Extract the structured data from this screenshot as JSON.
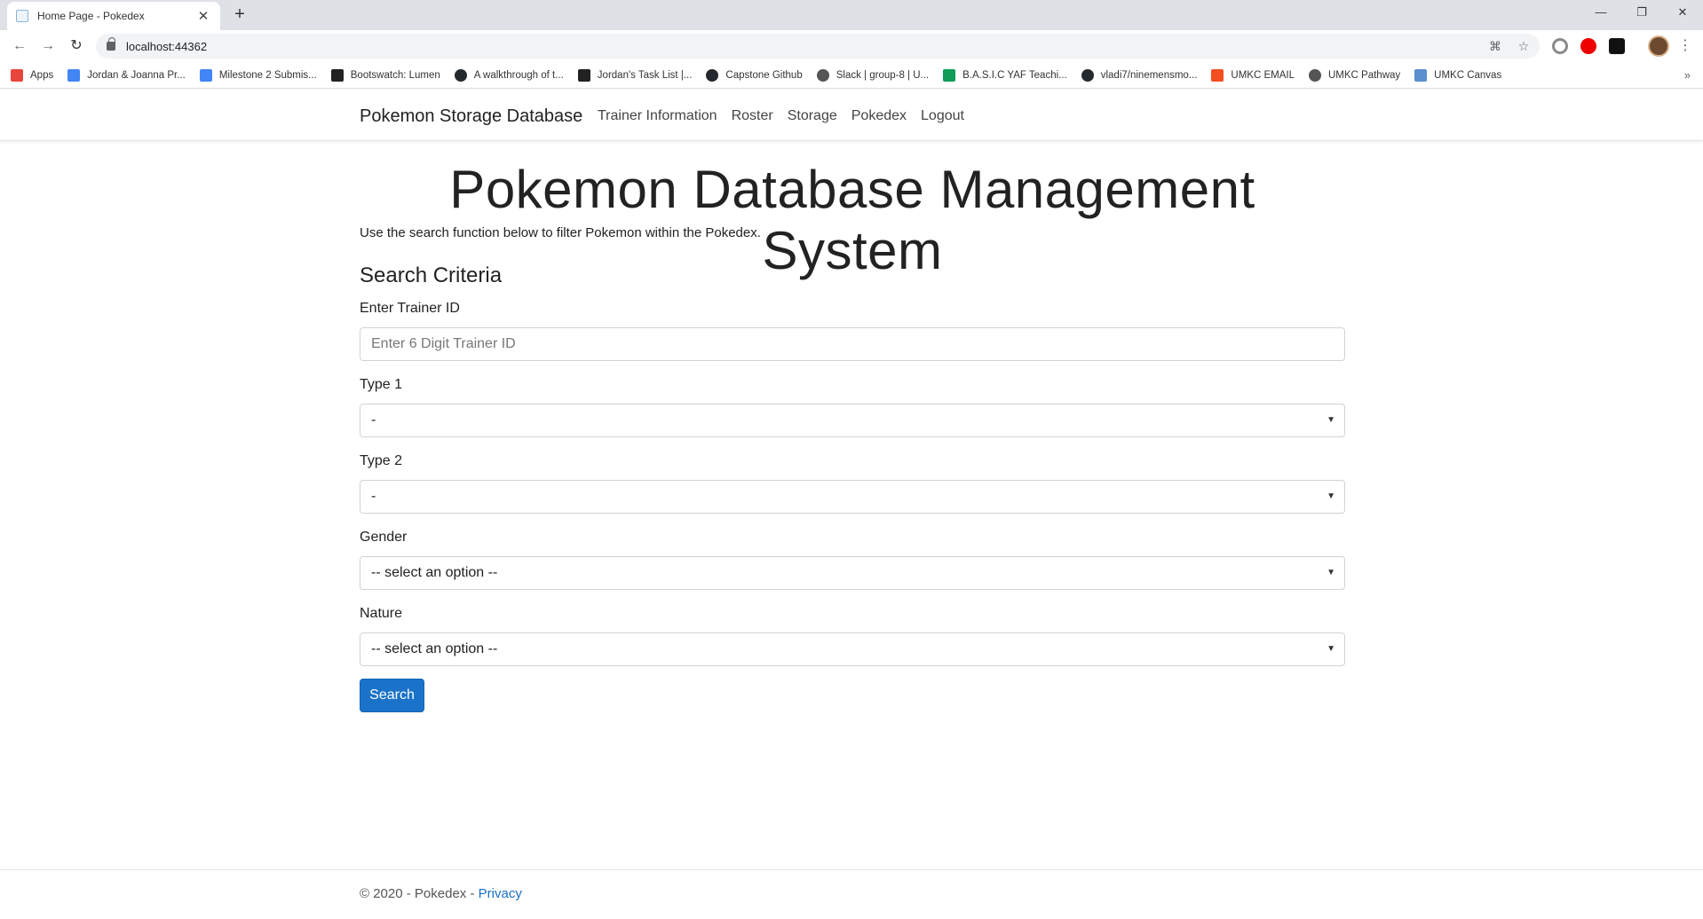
{
  "browser": {
    "tab_title": "Home Page - Pokedex",
    "url": "localhost:44362",
    "bookmarks": [
      {
        "label": "Apps",
        "icon": "apps-grid-icon",
        "color": "#e8453c"
      },
      {
        "label": "Jordan & Joanna Pr...",
        "icon": "google-docs-icon",
        "color": "#4285f4"
      },
      {
        "label": "Milestone 2 Submis...",
        "icon": "google-docs-icon",
        "color": "#4285f4"
      },
      {
        "label": "Bootswatch: Lumen",
        "icon": "bootswatch-icon",
        "color": "#222222"
      },
      {
        "label": "A walkthrough of t...",
        "icon": "github-icon",
        "color": "#24292e"
      },
      {
        "label": "Jordan's Task List |...",
        "icon": "trello-icon",
        "color": "#222222"
      },
      {
        "label": "Capstone Github",
        "icon": "github-icon",
        "color": "#24292e"
      },
      {
        "label": "Slack | group-8 | U...",
        "icon": "globe-icon",
        "color": "#555555"
      },
      {
        "label": "B.A.S.I.C YAF Teachi...",
        "icon": "google-sheets-icon",
        "color": "#0f9d58"
      },
      {
        "label": "vladi7/ninemensmo...",
        "icon": "github-icon",
        "color": "#24292e"
      },
      {
        "label": "UMKC EMAIL",
        "icon": "microsoft-icon",
        "color": "#f25022"
      },
      {
        "label": "UMKC Pathway",
        "icon": "globe-icon",
        "color": "#555555"
      },
      {
        "label": "UMKC Canvas",
        "icon": "umkc-icon",
        "color": "#5b8fd0"
      }
    ]
  },
  "nav": {
    "brand": "Pokemon Storage Database",
    "links": [
      "Trainer Information",
      "Roster",
      "Storage",
      "Pokedex",
      "Logout"
    ]
  },
  "main": {
    "title": "Pokemon Database Management System",
    "intro": "Use the search function below to filter Pokemon within the Pokedex.",
    "section_title": "Search Criteria",
    "trainer_label": "Enter Trainer ID",
    "trainer_placeholder": "Enter 6 Digit Trainer ID",
    "type1_label": "Type 1",
    "type1_value": "-",
    "type2_label": "Type 2",
    "type2_value": "-",
    "gender_label": "Gender",
    "gender_value": "-- select an option --",
    "nature_label": "Nature",
    "nature_value": "-- select an option --",
    "search_button": "Search"
  },
  "footer": {
    "copyright": "© 2020 - Pokedex -",
    "privacy_link": "Privacy"
  },
  "colors": {
    "primary_button": "#1a73c8",
    "link": "#1a6fc4"
  }
}
